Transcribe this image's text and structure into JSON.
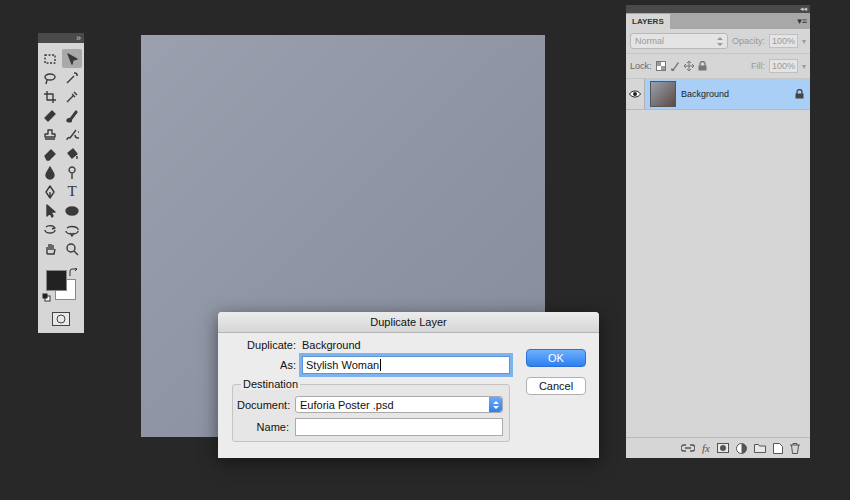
{
  "tools_panel": {
    "collapse_icon": "»",
    "tools": [
      {
        "kind": "marquee",
        "selected": false
      },
      {
        "kind": "move",
        "selected": true
      },
      {
        "kind": "lasso",
        "selected": false
      },
      {
        "kind": "wand",
        "selected": false
      },
      {
        "kind": "crop",
        "selected": false
      },
      {
        "kind": "eyedropper",
        "selected": false
      },
      {
        "kind": "heal",
        "selected": false
      },
      {
        "kind": "brush",
        "selected": false
      },
      {
        "kind": "stamp",
        "selected": false
      },
      {
        "kind": "history",
        "selected": false
      },
      {
        "kind": "eraser",
        "selected": false
      },
      {
        "kind": "bucket",
        "selected": false
      },
      {
        "kind": "blur",
        "selected": false
      },
      {
        "kind": "dodge",
        "selected": false
      },
      {
        "kind": "pen",
        "selected": false
      },
      {
        "kind": "type",
        "label": "T",
        "selected": false
      },
      {
        "kind": "pathselect",
        "selected": false
      },
      {
        "kind": "shape",
        "selected": false
      },
      {
        "kind": "rotate3d",
        "selected": false
      },
      {
        "kind": "orbit3d",
        "selected": false
      },
      {
        "kind": "hand",
        "selected": false
      },
      {
        "kind": "zoom",
        "selected": false
      }
    ]
  },
  "layers_panel": {
    "collapse_icon": "◂◂",
    "menu_icon": "▾≡",
    "tab": "LAYERS",
    "blend_mode": {
      "value": "Normal",
      "disabled": true
    },
    "opacity": {
      "label": "Opacity:",
      "value": "100%",
      "disabled": true
    },
    "lock_label": "Lock:",
    "fill": {
      "label": "Fill:",
      "value": "100%",
      "disabled": true
    },
    "layers": [
      {
        "name": "Background",
        "visible": true,
        "locked": true,
        "selected": true
      }
    ],
    "footer_fx": "fx"
  },
  "dialog": {
    "title": "Duplicate Layer",
    "duplicate_label": "Duplicate:",
    "duplicate_value": "Background",
    "as_label": "As:",
    "as_value": "Stylish Woman",
    "destination_label": "Destination",
    "document_label": "Document:",
    "document_value": "Euforia Poster .psd",
    "name_label": "Name:",
    "name_value": "",
    "buttons": [
      {
        "label": "OK",
        "default": true
      },
      {
        "label": "Cancel",
        "default": false
      }
    ]
  }
}
